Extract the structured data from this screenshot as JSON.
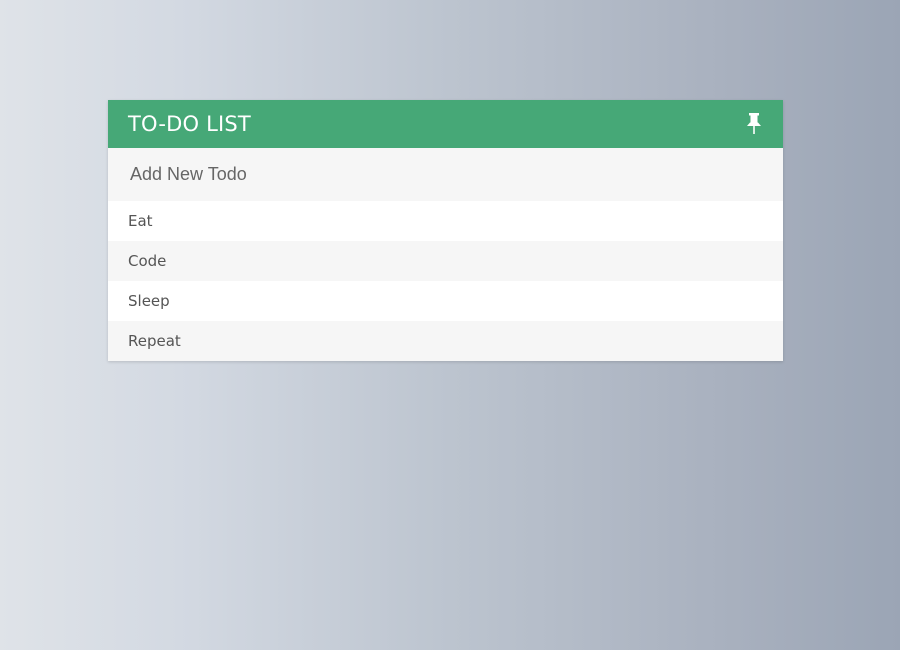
{
  "todo": {
    "title": "TO-DO LIST",
    "pin_icon": "pin-icon",
    "input_placeholder": "Add New Todo",
    "input_value": "",
    "items": [
      {
        "label": "Eat"
      },
      {
        "label": "Code"
      },
      {
        "label": "Sleep"
      },
      {
        "label": "Repeat"
      }
    ]
  },
  "colors": {
    "header_bg": "#46a877",
    "header_text": "#ffffff",
    "item_text": "#555555"
  }
}
